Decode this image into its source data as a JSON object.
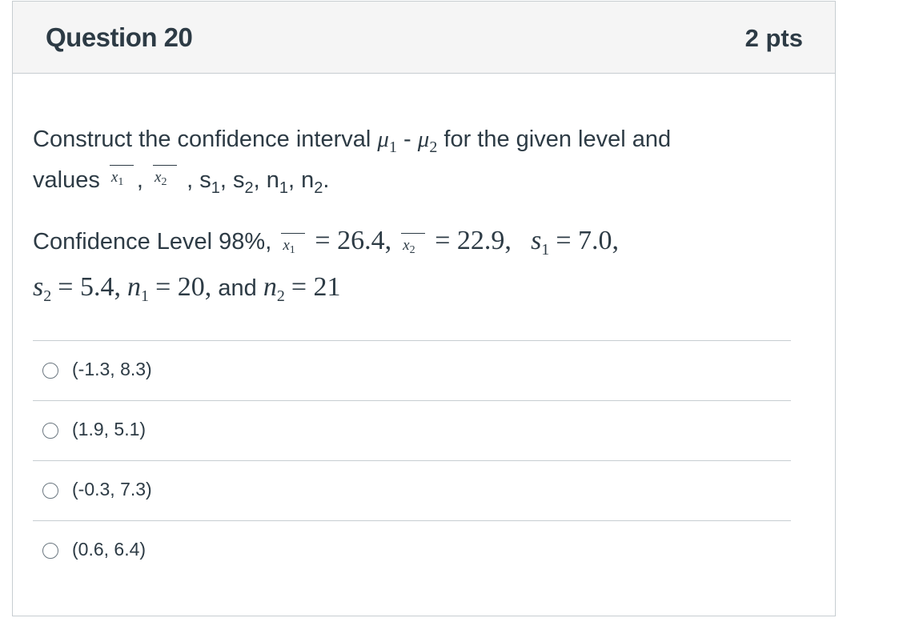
{
  "question": {
    "title": "Question 20",
    "points": "2 pts"
  },
  "prompt": {
    "line1_prefix": "Construct the confidence interval",
    "mu": "μ",
    "sub1": "1",
    "minus": "-",
    "sub2": "2",
    "line1_suffix": "for the given level and",
    "line2_prefix": "values",
    "x": "x",
    "vars_tail": ", s",
    "s_sub1": "1",
    "s2": ", s",
    "s_sub2": "2",
    "n1": ", n",
    "n_sub1": "1",
    "n2": ", n",
    "n_sub2": "2",
    "end": "."
  },
  "given": {
    "confidence_label": "Confidence Level 98%,",
    "x1_value": "= 26.4,",
    "x2_value": "= 22.9,",
    "s1_label": "s",
    "s1_value": "= 7.0,",
    "s2_label": "s",
    "s2_value": "= 5.4,",
    "n1_label": "n",
    "n1_value": "= 20,",
    "and": "and",
    "n2_label": "n",
    "n2_value": "= 21"
  },
  "answers": [
    {
      "label": "(-1.3, 8.3)",
      "selected": false
    },
    {
      "label": "(1.9, 5.1)",
      "selected": false
    },
    {
      "label": "(-0.3, 7.3)",
      "selected": false
    },
    {
      "label": "(0.6, 6.4)",
      "selected": false
    }
  ]
}
